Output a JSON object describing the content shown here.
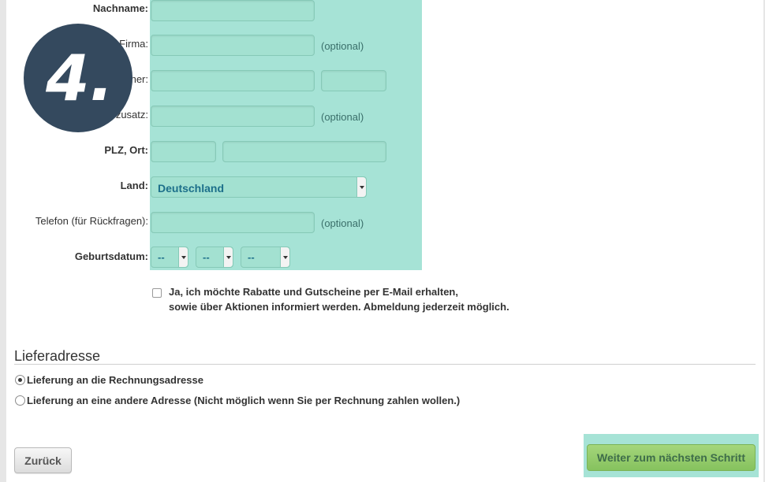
{
  "step_badge": "4.",
  "form": {
    "lastname_label": "Nachname:",
    "company_label": "Firma:",
    "company_optional": "(optional)",
    "street_label": "her:",
    "addition_label": "zusatz:",
    "addition_optional": "(optional)",
    "zip_city_label": "PLZ, Ort:",
    "country_label": "Land:",
    "country_value": "Deutschland",
    "phone_label": "Telefon (für Rückfragen):",
    "phone_optional": "(optional)",
    "birthdate_label": "Geburtsdatum:",
    "birth_day": "--",
    "birth_month": "--",
    "birth_year": "--"
  },
  "newsletter": {
    "line1": "Ja, ich möchte Rabatte und Gutscheine per E-Mail erhalten,",
    "line2": "sowie über Aktionen informiert werden. Abmeldung jederzeit möglich.",
    "checked": false
  },
  "delivery": {
    "title": "Lieferadresse",
    "options": [
      {
        "label": "Lieferung an die Rechnungsadresse",
        "checked": true
      },
      {
        "label": "Lieferung an eine andere Adresse (Nicht möglich wenn Sie per Rechnung zahlen wollen.)",
        "checked": false
      }
    ]
  },
  "buttons": {
    "back": "Zurück",
    "next": "Weiter zum nächsten Schritt"
  },
  "colors": {
    "highlight": "#a6e3d6",
    "badge": "#34495e",
    "next_button": "#8cc763"
  }
}
